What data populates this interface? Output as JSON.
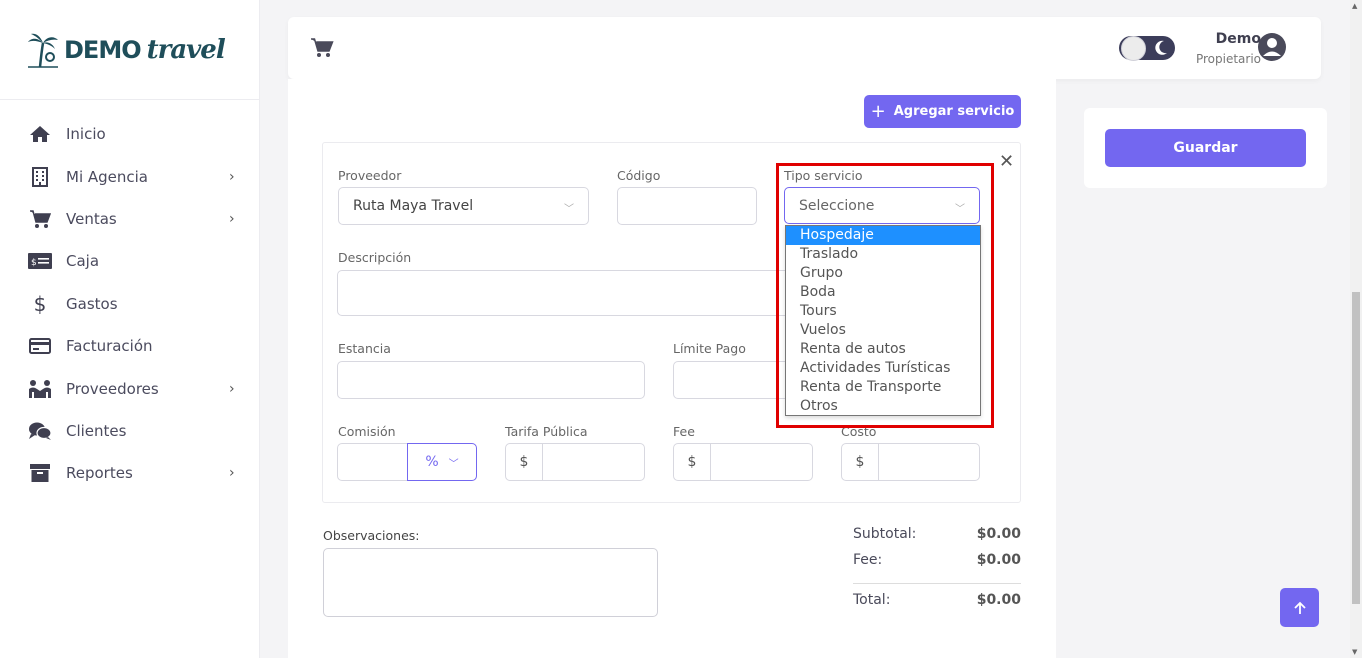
{
  "brand": {
    "name_bold": "DEMO",
    "name_script": "travel"
  },
  "sidebar": {
    "items": [
      {
        "label": "Inicio",
        "icon": "home-icon",
        "has_submenu": false
      },
      {
        "label": "Mi Agencia",
        "icon": "building-icon",
        "has_submenu": true
      },
      {
        "label": "Ventas",
        "icon": "cart-icon",
        "has_submenu": true
      },
      {
        "label": "Caja",
        "icon": "cash-icon",
        "has_submenu": false
      },
      {
        "label": "Gastos",
        "icon": "dollar-icon",
        "has_submenu": false
      },
      {
        "label": "Facturación",
        "icon": "credit-card-icon",
        "has_submenu": false
      },
      {
        "label": "Proveedores",
        "icon": "people-icon",
        "has_submenu": true
      },
      {
        "label": "Clientes",
        "icon": "chat-icon",
        "has_submenu": false
      },
      {
        "label": "Reportes",
        "icon": "archive-icon",
        "has_submenu": true
      }
    ]
  },
  "topbar": {
    "user_name": "Demo",
    "user_role": "Propietario"
  },
  "actions": {
    "add_service": "Agregar servicio",
    "save": "Guardar"
  },
  "form": {
    "proveedor": {
      "label": "Proveedor",
      "value": "Ruta Maya Travel"
    },
    "codigo": {
      "label": "Código",
      "value": ""
    },
    "tipo_servicio": {
      "label": "Tipo servicio",
      "placeholder": "Seleccione",
      "options": [
        "Hospedaje",
        "Traslado",
        "Grupo",
        "Boda",
        "Tours",
        "Vuelos",
        "Renta de autos",
        "Actividades Turísticas",
        "Renta de Transporte",
        "Otros"
      ],
      "highlighted": "Hospedaje"
    },
    "descripcion": {
      "label": "Descripción"
    },
    "estancia": {
      "label": "Estancia"
    },
    "limite_pago": {
      "label": "Límite Pago"
    },
    "comision": {
      "label": "Comisión",
      "unit": "%"
    },
    "tarifa_publica": {
      "label": "Tarifa Pública",
      "prefix": "$"
    },
    "fee": {
      "label": "Fee",
      "prefix": "$"
    },
    "costo": {
      "label": "Costo",
      "prefix": "$"
    }
  },
  "observaciones": {
    "label": "Observaciones:"
  },
  "totals": {
    "subtotal_label": "Subtotal:",
    "subtotal": "$0.00",
    "fee_label": "Fee:",
    "fee": "$0.00",
    "total_label": "Total:",
    "total": "$0.00"
  },
  "colors": {
    "accent": "#7367f0",
    "highlight_box": "#e00000",
    "option_selected": "#1e90ff"
  }
}
